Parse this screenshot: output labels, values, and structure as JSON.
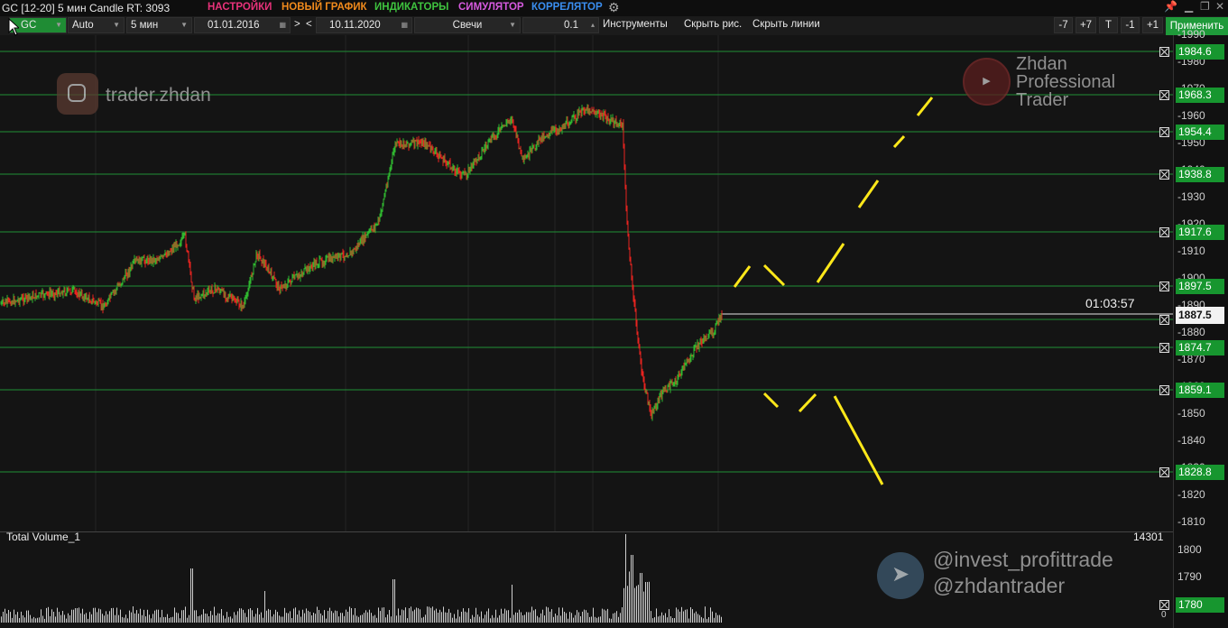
{
  "window": {
    "title": "GC [12-20] 5 мин Candle RT: 3093",
    "menu": [
      {
        "label": "НАСТРОЙКИ",
        "color": "#e8327a"
      },
      {
        "label": "НОВЫЙ ГРАФИК",
        "color": "#f08a1c"
      },
      {
        "label": "ИНДИКАТОРЫ",
        "color": "#3fc43f"
      },
      {
        "label": "СИМУЛЯТОР",
        "color": "#d65adf"
      },
      {
        "label": "КОРРЕЛЯТОР",
        "color": "#3a8ef0"
      }
    ],
    "settings_icon": "gears-icon",
    "controls": [
      "pin-icon",
      "minimize-icon",
      "restore-icon",
      "close-icon"
    ]
  },
  "toolbar": {
    "symbol": "GC",
    "scale": "Auto",
    "timeframe": "5 мин",
    "date_from": "01.01.2016",
    "nav_next": ">",
    "nav_prev": "<",
    "date_to": "10.11.2020",
    "chart_type": "Свечи",
    "tick_size": "0.1",
    "tools": "Инструменты",
    "hide_drawings": "Скрыть рис.",
    "hide_lines": "Скрыть линии",
    "buttons": [
      "-7",
      "+7",
      "T",
      "-1",
      "+1"
    ],
    "apply": "Применить"
  },
  "price_axis": {
    "ticks": [
      "1990",
      "1980",
      "1970",
      "1960",
      "1950",
      "1940",
      "1930",
      "1920",
      "1910",
      "1900",
      "1890",
      "1880",
      "1870",
      "1860",
      "1850",
      "1840",
      "1830",
      "1820",
      "1810"
    ],
    "levels": [
      "1984.6",
      "1968.3",
      "1954.4",
      "1938.8",
      "1917.6",
      "1897.5",
      "1874.7",
      "1859.1",
      "1828.8"
    ],
    "current_price": "1887.5",
    "candle_timer": "01:03:57",
    "colors": {
      "level": "#17962f",
      "bull": "#2fb82f",
      "bear": "#e8231f",
      "projection": "#ffe81a"
    }
  },
  "volume": {
    "label": "Total Volume_1",
    "max_value": "14301",
    "ticks": [
      "1800",
      "1790",
      "1780"
    ],
    "level": "1780",
    "zero": "0"
  },
  "watermarks": {
    "instagram": "trader.zhdan",
    "brand": [
      "Zhdan",
      "Professional",
      "Trader"
    ],
    "youtube_icon": "youtube-icon",
    "telegram_handles": [
      "@invest_profittrade",
      "@zhdantrader"
    ]
  }
}
